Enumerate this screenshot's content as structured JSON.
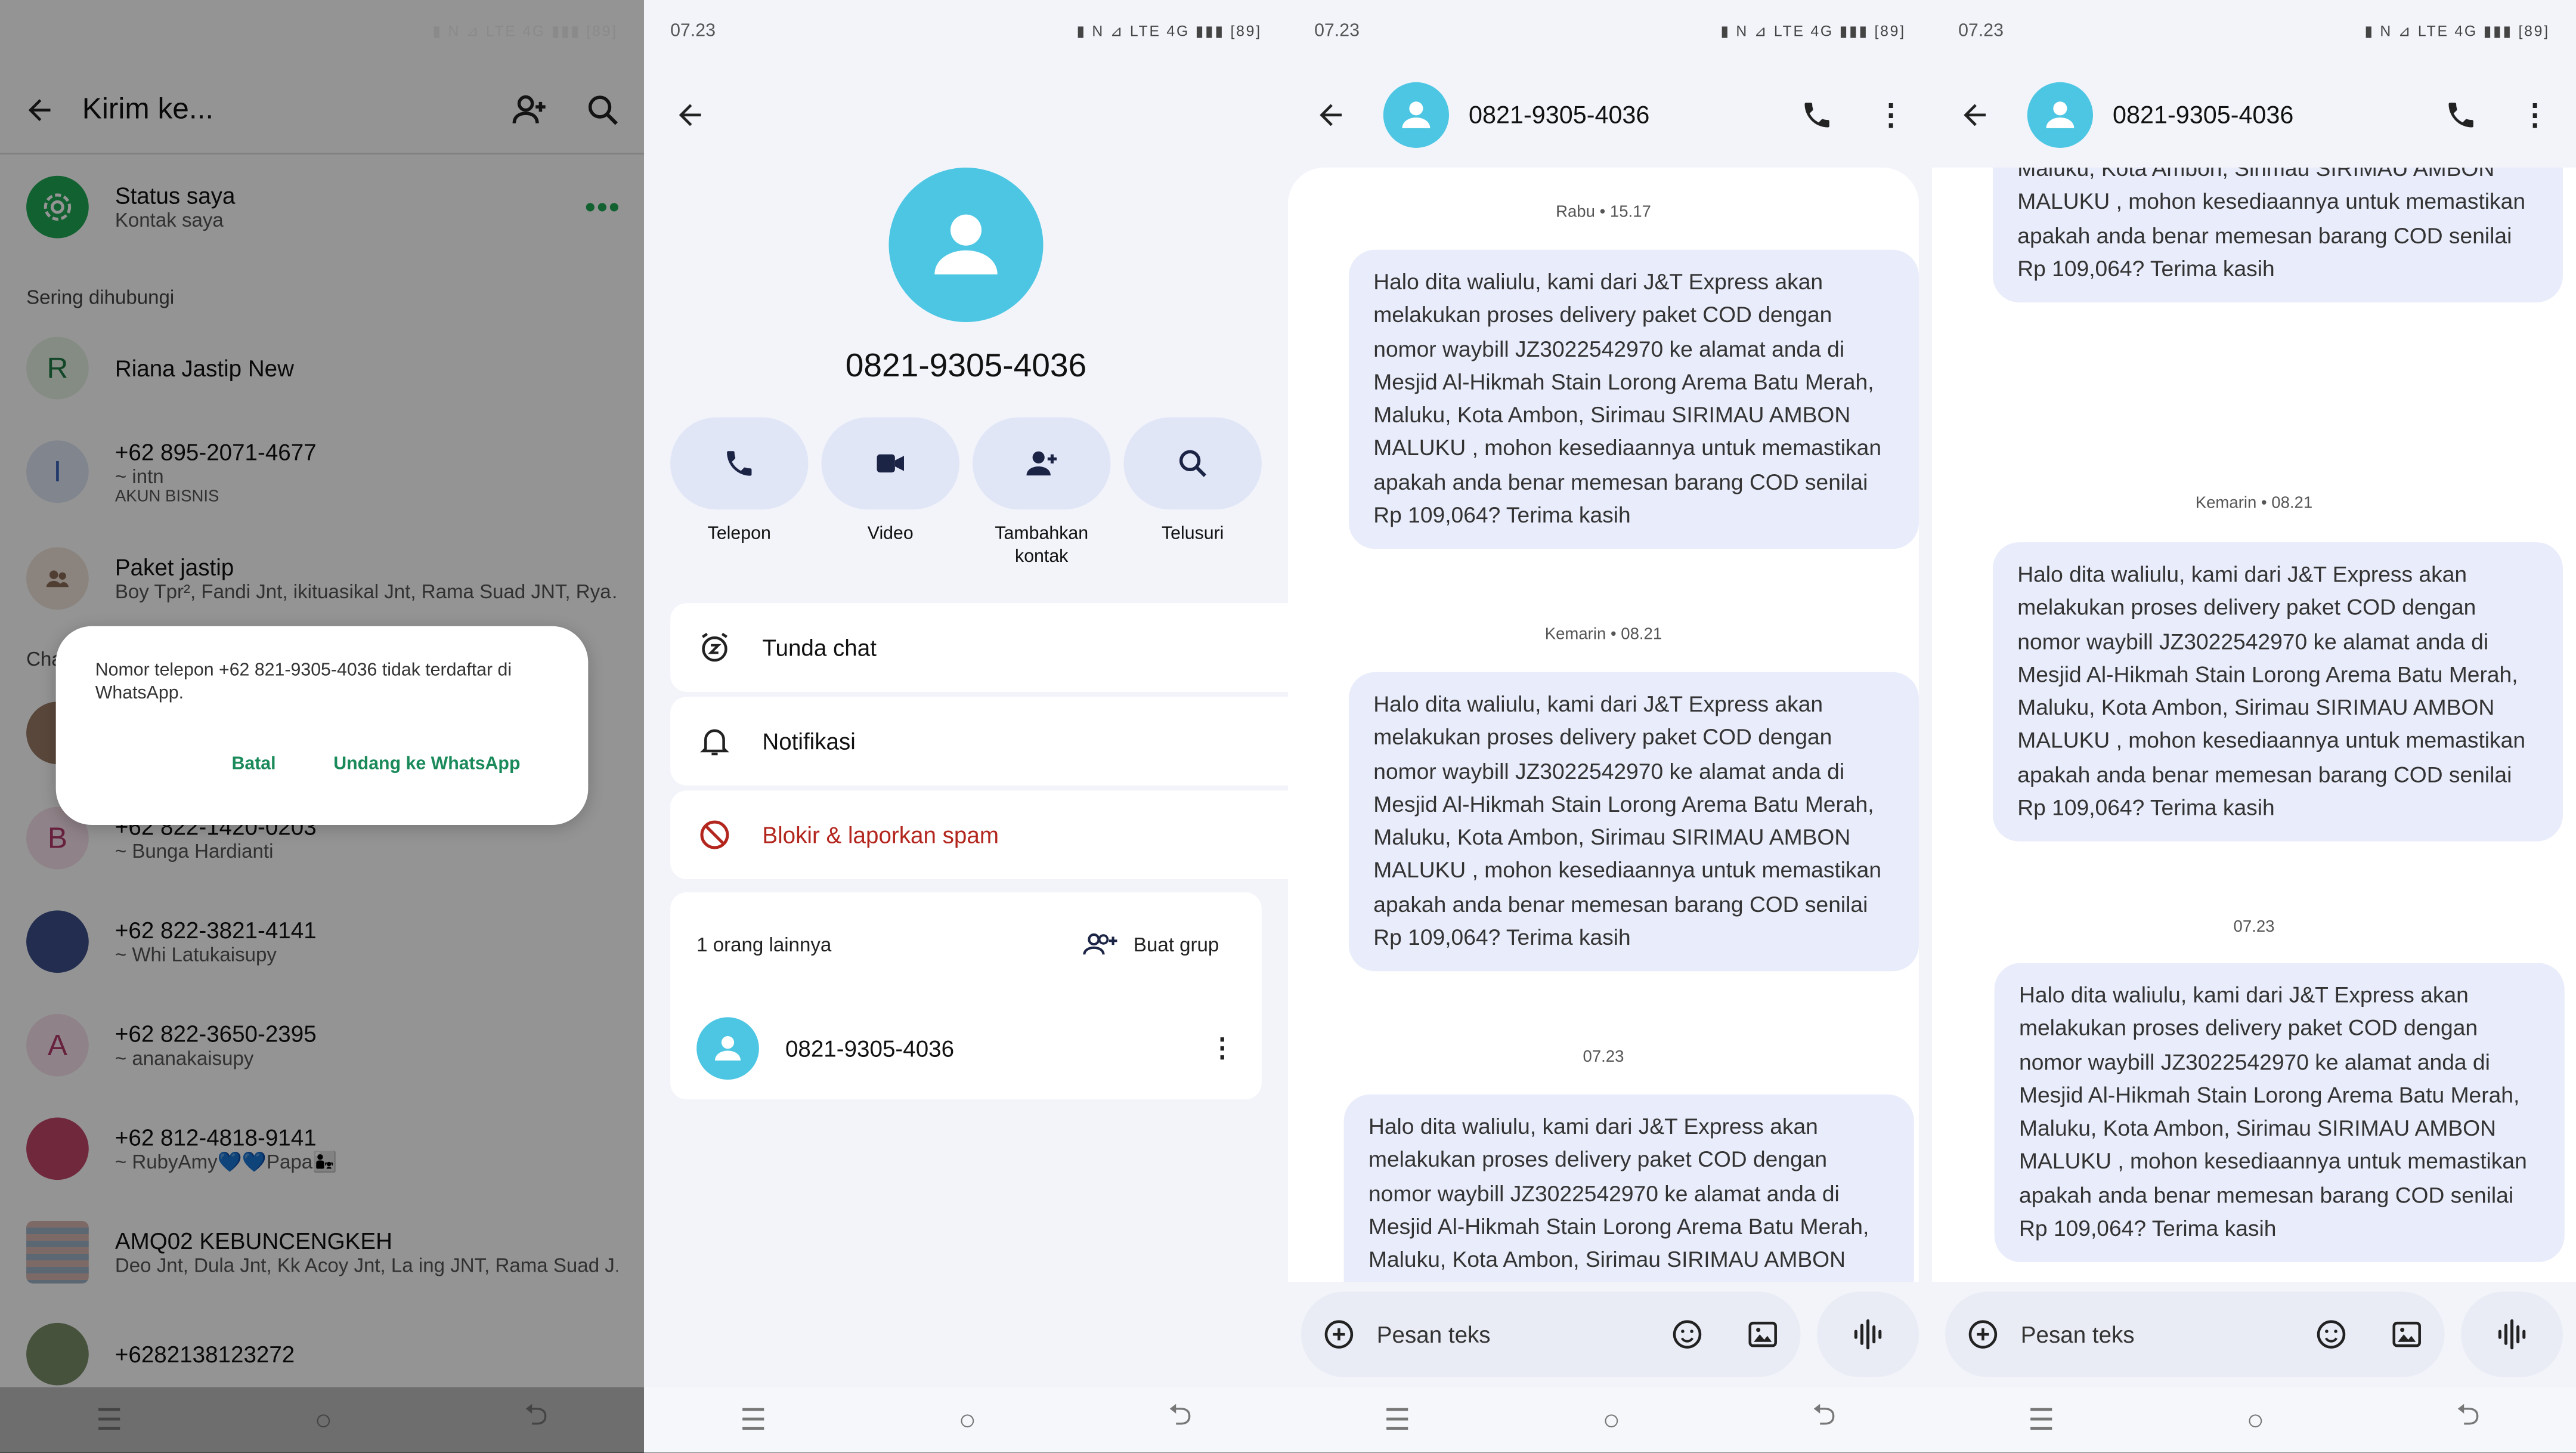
{
  "time": "07.23",
  "battery": "89",
  "panel1": {
    "title": "Kirim ke...",
    "status_name": "Status saya",
    "status_sub": "Kontak saya",
    "section_frequent": "Sering dihubungi",
    "section_chats": "Cha",
    "contacts": [
      {
        "initial": "R",
        "name": "Riana Jastip New",
        "sub": ""
      },
      {
        "initial": "I",
        "name": "+62 895-2071-4677",
        "sub": "~ intn",
        "sub2": "AKUN BISNIS"
      },
      {
        "initial": "",
        "name": "Paket jastip",
        "sub": "Boy Tpr², Fandi Jnt, ikituasikal Jnt, Rama Suad JNT, Ryan..."
      },
      {
        "initial": "B",
        "name": "+62 822-1420-0203",
        "sub": "~ Bunga Hardianti"
      },
      {
        "initial": "",
        "name": "+62 822-3821-4141",
        "sub": "~ Whi Latukaisupy"
      },
      {
        "initial": "A",
        "name": "+62 822-3650-2395",
        "sub": "~ ananakaisupy"
      },
      {
        "initial": "",
        "name": "+62 812-4818-9141",
        "sub": "~ RubyAmy💙💙Papa👨‍👧"
      },
      {
        "initial": "",
        "name": "AMQ02 KEBUNCENGKEH",
        "sub": "Deo Jnt, Dula Jnt, Kk Acoy Jnt, La ing JNT, Rama Suad J..."
      },
      {
        "initial": "",
        "name": "+6282138123272",
        "sub": ""
      }
    ],
    "dialog": {
      "message": "Nomor telepon +62 821-9305-4036 tidak terdaftar di WhatsApp.",
      "cancel": "Batal",
      "invite": "Undang ke WhatsApp"
    }
  },
  "panel2": {
    "number": "0821-9305-4036",
    "actions": [
      "Telepon",
      "Video",
      "Tambahkan kontak",
      "Telusuri"
    ],
    "menu": [
      "Tunda chat",
      "Notifikasi",
      "Blokir & laporkan spam"
    ],
    "others": "1 orang lainnya",
    "create_group": "Buat grup",
    "member": "0821-9305-4036"
  },
  "chat": {
    "number": "0821-9305-4036",
    "stamps": [
      "Rabu • 15.17",
      "Kemarin • 08.21",
      "07.23"
    ],
    "message": "Halo dita waliulu, kami dari J&T Express akan melakukan proses delivery paket COD dengan nomor waybill JZ3022542970 ke alamat anda di Mesjid Al-Hikmah Stain Lorong Arema Batu Merah, Maluku, Kota Ambon, Sirimau SIRIMAU AMBON MALUKU , mohon kesediaannya untuk memastikan apakah anda benar memesan barang COD senilai Rp 109,064? Terima kasih",
    "placeholder": "Pesan teks"
  },
  "colors": {
    "whatsapp_green": "#1a8a5a",
    "avatar_blue": "#4cc6e3",
    "danger": "#b3261e",
    "bubble": "#e9ecfa"
  }
}
